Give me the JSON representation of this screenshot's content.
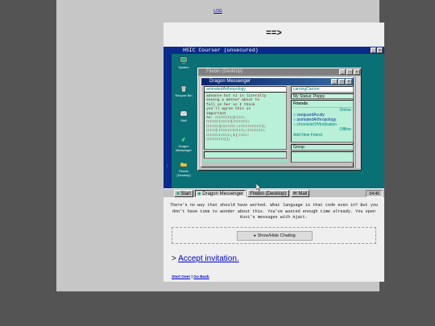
{
  "page": {
    "log_link": "LOG",
    "arrow": "==>",
    "narrative": "There's no way that should have worked. What language is that code even in? But you don't have time to wonder about this. You've wasted enough time already. You open Kuvi's messages with Ajact.",
    "chatlog_button": "▸ Show/Hide Chatlog",
    "accept_prefix": ">",
    "accept_link": "Accept invitation.",
    "footer_start_over": "Start Over",
    "footer_sep": "|",
    "footer_go_back": "Go Back"
  },
  "desktop": {
    "title": "HSIC Courser (unsecured)",
    "sidebar_text": "...",
    "icons": [
      {
        "label": "System",
        "icon": "computer-icon"
      },
      {
        "label": "Recycle Bin",
        "icon": "recycle-bin-icon"
      },
      {
        "label": "Mail",
        "icon": "mail-icon"
      },
      {
        "label": "Dragon Messenger",
        "icon": "dragon-icon"
      },
      {
        "label": "Filebin (Desktop)",
        "icon": "folder-icon"
      }
    ],
    "filebin_window_title": "Filebin (Desktop)",
    "messenger": {
      "title": "Dragon Messenger",
      "chat_with": "animatedArthropology",
      "self_handle": "carvingCarrion",
      "status": "My Status: Peppy",
      "chat_lines": [
        "advance but AJ is literally",
        "seeing a meteor about to",
        "fall on her so I think",
        "you'll agree this is",
        "important",
        "AA: □□□□□□□□(□□□□.",
        "□□□□□□□□□□□(□□□□□□□.",
        "□□□□□□(□□□□□□.□□□□□□□□□□□);",
        "□□□□(□□□□□□□□□□□□,□□□□□□□□.",
        "□□□□□□□□□□□,1);□□□□",
        "□□□□□□□□();"
      ],
      "friends_header": "Friends",
      "online_label": "Online",
      "offline_label": "Offline",
      "friends_online": [
        "vanguardAcuity",
        "animatedArthropology"
      ],
      "friends_offline": [
        "chronicleOfVindication"
      ],
      "add_friend": "Add New Friend",
      "group_label": "Group"
    },
    "taskbar": {
      "start": "Start",
      "buttons": [
        "Dragon Messenger",
        "Filebin (Desktop)",
        "Mail"
      ],
      "clock": "04:46"
    }
  }
}
